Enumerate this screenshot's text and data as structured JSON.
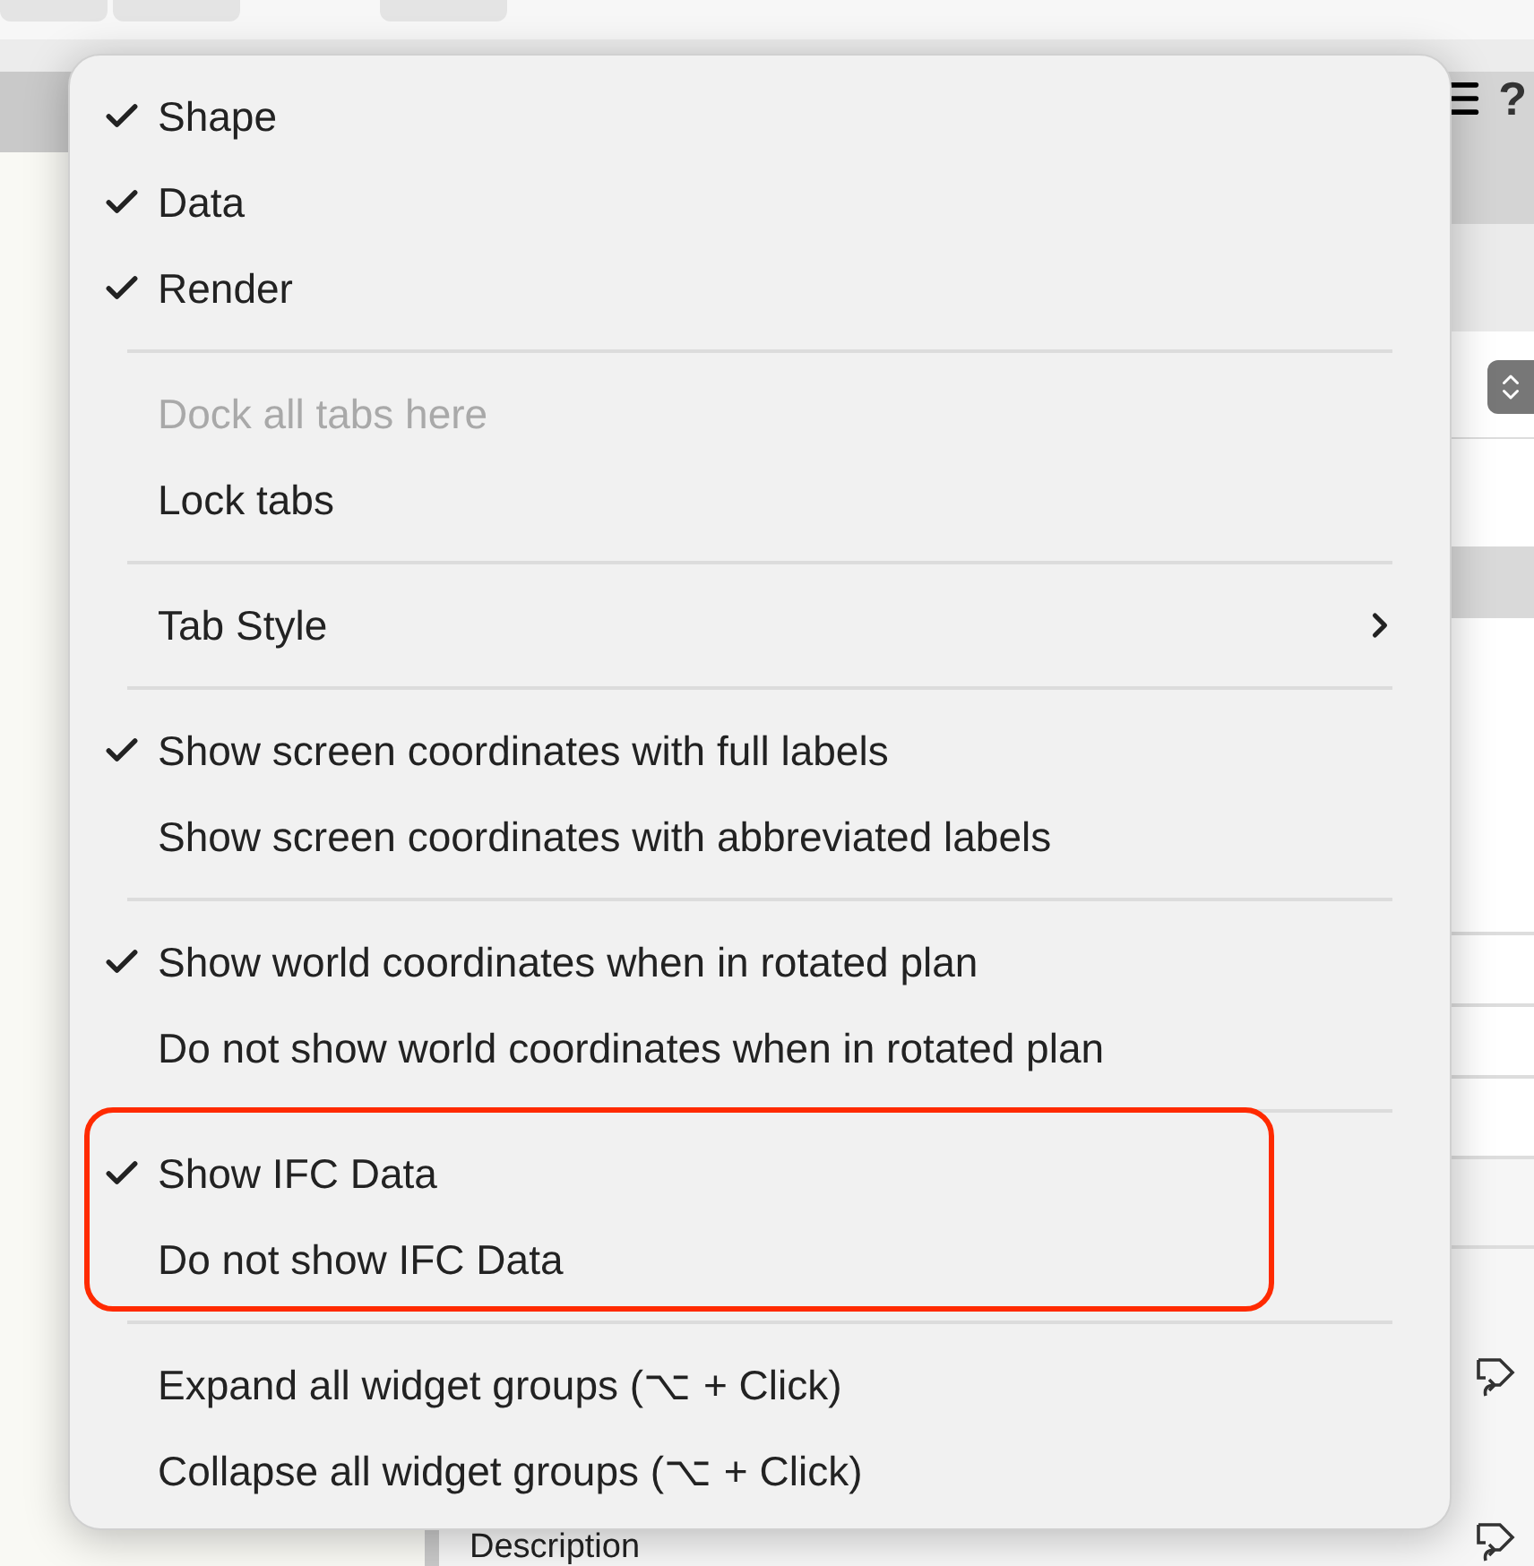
{
  "background": {
    "help_label": "?",
    "field_label": "Description"
  },
  "menu": {
    "sections": [
      {
        "highlighted": false,
        "items": [
          {
            "label": "Shape",
            "checked": true,
            "disabled": false,
            "has_submenu": false
          },
          {
            "label": "Data",
            "checked": true,
            "disabled": false,
            "has_submenu": false
          },
          {
            "label": "Render",
            "checked": true,
            "disabled": false,
            "has_submenu": false
          }
        ]
      },
      {
        "highlighted": false,
        "items": [
          {
            "label": "Dock all tabs here",
            "checked": false,
            "disabled": true,
            "has_submenu": false
          },
          {
            "label": "Lock tabs",
            "checked": false,
            "disabled": false,
            "has_submenu": false
          }
        ]
      },
      {
        "highlighted": false,
        "items": [
          {
            "label": "Tab Style",
            "checked": false,
            "disabled": false,
            "has_submenu": true
          }
        ]
      },
      {
        "highlighted": false,
        "items": [
          {
            "label": "Show screen coordinates with full labels",
            "checked": true,
            "disabled": false,
            "has_submenu": false
          },
          {
            "label": "Show screen coordinates with abbreviated labels",
            "checked": false,
            "disabled": false,
            "has_submenu": false
          }
        ]
      },
      {
        "highlighted": false,
        "items": [
          {
            "label": "Show world coordinates when in rotated plan",
            "checked": true,
            "disabled": false,
            "has_submenu": false
          },
          {
            "label": "Do not show world coordinates when in rotated plan",
            "checked": false,
            "disabled": false,
            "has_submenu": false
          }
        ]
      },
      {
        "highlighted": true,
        "items": [
          {
            "label": "Show IFC Data",
            "checked": true,
            "disabled": false,
            "has_submenu": false
          },
          {
            "label": "Do not show IFC Data",
            "checked": false,
            "disabled": false,
            "has_submenu": false
          }
        ]
      },
      {
        "highlighted": false,
        "items": [
          {
            "label": "Expand all widget groups (⌥ + Click)",
            "checked": false,
            "disabled": false,
            "has_submenu": false
          },
          {
            "label": "Collapse all widget groups (⌥ + Click)",
            "checked": false,
            "disabled": false,
            "has_submenu": false
          }
        ]
      }
    ]
  }
}
